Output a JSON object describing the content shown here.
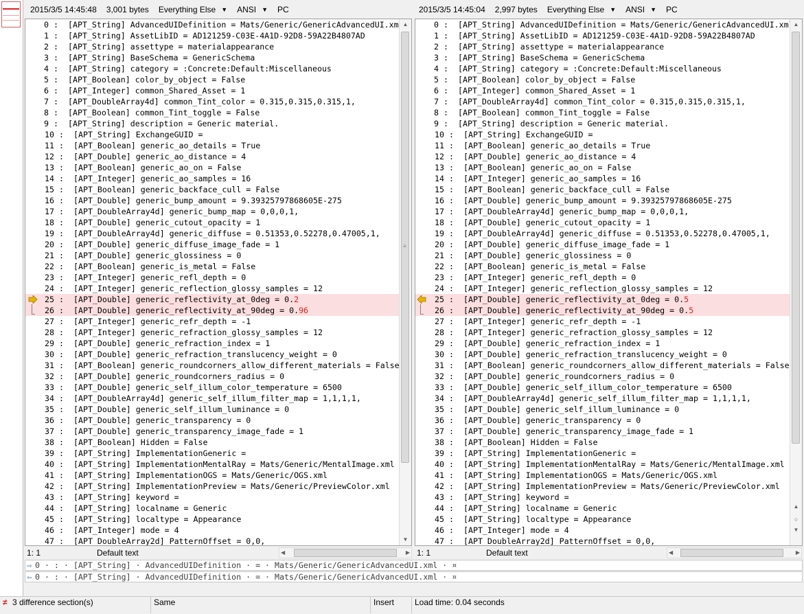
{
  "left": {
    "header": {
      "date": "2015/3/5 14:45:48",
      "size": "3,001 bytes",
      "filter": "Everything Else",
      "encoding": "ANSI",
      "line_ending": "PC"
    },
    "status": {
      "position": "1: 1",
      "style": "Default text"
    },
    "lines": [
      {
        "n": "0",
        "t": "[APT_String] AdvancedUIDefinition = Mats/Generic/GenericAdvancedUI.xml"
      },
      {
        "n": "1",
        "t": "[APT_String] AssetLibID = AD121259-C03E-4A1D-92D8-59A22B4807AD"
      },
      {
        "n": "2",
        "t": "[APT_String] assettype = materialappearance"
      },
      {
        "n": "3",
        "t": "[APT_String] BaseSchema = GenericSchema"
      },
      {
        "n": "4",
        "t": "[APT_String] category = :Concrete:Default:Miscellaneous"
      },
      {
        "n": "5",
        "t": "[APT_Boolean] color_by_object = False"
      },
      {
        "n": "6",
        "t": "[APT_Integer] common_Shared_Asset = 1"
      },
      {
        "n": "7",
        "t": "[APT_DoubleArray4d] common_Tint_color = 0.315,0.315,0.315,1,"
      },
      {
        "n": "8",
        "t": "[APT_Boolean] common_Tint_toggle = False"
      },
      {
        "n": "9",
        "t": "[APT_String] description = Generic material."
      },
      {
        "n": "10",
        "t": "[APT_String] ExchangeGUID ="
      },
      {
        "n": "11",
        "t": "[APT_Boolean] generic_ao_details = True"
      },
      {
        "n": "12",
        "t": "[APT_Double] generic_ao_distance = 4"
      },
      {
        "n": "13",
        "t": "[APT_Boolean] generic_ao_on = False"
      },
      {
        "n": "14",
        "t": "[APT_Integer] generic_ao_samples = 16"
      },
      {
        "n": "15",
        "t": "[APT_Boolean] generic_backface_cull = False"
      },
      {
        "n": "16",
        "t": "[APT_Double] generic_bump_amount = 9.39325797868605E-275"
      },
      {
        "n": "17",
        "t": "[APT_DoubleArray4d] generic_bump_map = 0,0,0,1,"
      },
      {
        "n": "18",
        "t": "[APT_Double] generic_cutout_opacity = 1"
      },
      {
        "n": "19",
        "t": "[APT_DoubleArray4d] generic_diffuse = 0.51353,0.52278,0.47005,1,"
      },
      {
        "n": "20",
        "t": "[APT_Double] generic_diffuse_image_fade = 1"
      },
      {
        "n": "21",
        "t": "[APT_Double] generic_glossiness = 0"
      },
      {
        "n": "22",
        "t": "[APT_Boolean] generic_is_metal = False"
      },
      {
        "n": "23",
        "t": "[APT_Integer] generic_refl_depth = 0"
      },
      {
        "n": "24",
        "t": "[APT_Integer] generic_reflection_glossy_samples = 12"
      },
      {
        "n": "25",
        "t": "[APT_Double] generic_reflectivity_at_0deg = 0.",
        "c": "2",
        "diff": true
      },
      {
        "n": "26",
        "t": "[APT_Double] generic_reflectivity_at_90deg = 0.",
        "c": "96",
        "diff": true
      },
      {
        "n": "27",
        "t": "[APT_Integer] generic_refr_depth = -1"
      },
      {
        "n": "28",
        "t": "[APT_Integer] generic_refraction_glossy_samples = 12"
      },
      {
        "n": "29",
        "t": "[APT_Double] generic_refraction_index = 1"
      },
      {
        "n": "30",
        "t": "[APT_Double] generic_refraction_translucency_weight = 0"
      },
      {
        "n": "31",
        "t": "[APT_Boolean] generic_roundcorners_allow_different_materials = False"
      },
      {
        "n": "32",
        "t": "[APT_Double] generic_roundcorners_radius = 0"
      },
      {
        "n": "33",
        "t": "[APT_Double] generic_self_illum_color_temperature = 6500"
      },
      {
        "n": "34",
        "t": "[APT_DoubleArray4d] generic_self_illum_filter_map = 1,1,1,1,"
      },
      {
        "n": "35",
        "t": "[APT_Double] generic_self_illum_luminance = 0"
      },
      {
        "n": "36",
        "t": "[APT_Double] generic_transparency = 0"
      },
      {
        "n": "37",
        "t": "[APT_Double] generic_transparency_image_fade = 1"
      },
      {
        "n": "38",
        "t": "[APT_Boolean] Hidden = False"
      },
      {
        "n": "39",
        "t": "[APT_String] ImplementationGeneric ="
      },
      {
        "n": "40",
        "t": "[APT_String] ImplementationMentalRay = Mats/Generic/MentalImage.xml"
      },
      {
        "n": "41",
        "t": "[APT_String] ImplementationOGS = Mats/Generic/OGS.xml"
      },
      {
        "n": "42",
        "t": "[APT_String] ImplementationPreview = Mats/Generic/PreviewColor.xml"
      },
      {
        "n": "43",
        "t": "[APT_String] keyword ="
      },
      {
        "n": "44",
        "t": "[APT_String] localname = Generic"
      },
      {
        "n": "45",
        "t": "[APT_String] localtype = Appearance"
      },
      {
        "n": "46",
        "t": "[APT_Integer] mode = 4"
      },
      {
        "n": "47",
        "t": "[APT_DoubleArray2d] PatternOffset = 0,0,"
      }
    ]
  },
  "right": {
    "header": {
      "date": "2015/3/5 14:45:04",
      "size": "2,997 bytes",
      "filter": "Everything Else",
      "encoding": "ANSI",
      "line_ending": "PC"
    },
    "status": {
      "position": "1: 1",
      "style": "Default text"
    },
    "lines": [
      {
        "n": "0",
        "t": "[APT_String] AdvancedUIDefinition = Mats/Generic/GenericAdvancedUI.xml"
      },
      {
        "n": "1",
        "t": "[APT_String] AssetLibID = AD121259-C03E-4A1D-92D8-59A22B4807AD"
      },
      {
        "n": "2",
        "t": "[APT_String] assettype = materialappearance"
      },
      {
        "n": "3",
        "t": "[APT_String] BaseSchema = GenericSchema"
      },
      {
        "n": "4",
        "t": "[APT_String] category = :Concrete:Default:Miscellaneous"
      },
      {
        "n": "5",
        "t": "[APT_Boolean] color_by_object = False"
      },
      {
        "n": "6",
        "t": "[APT_Integer] common_Shared_Asset = 1"
      },
      {
        "n": "7",
        "t": "[APT_DoubleArray4d] common_Tint_color = 0.315,0.315,0.315,1,"
      },
      {
        "n": "8",
        "t": "[APT_Boolean] common_Tint_toggle = False"
      },
      {
        "n": "9",
        "t": "[APT_String] description = Generic material."
      },
      {
        "n": "10",
        "t": "[APT_String] ExchangeGUID ="
      },
      {
        "n": "11",
        "t": "[APT_Boolean] generic_ao_details = True"
      },
      {
        "n": "12",
        "t": "[APT_Double] generic_ao_distance = 4"
      },
      {
        "n": "13",
        "t": "[APT_Boolean] generic_ao_on = False"
      },
      {
        "n": "14",
        "t": "[APT_Integer] generic_ao_samples = 16"
      },
      {
        "n": "15",
        "t": "[APT_Boolean] generic_backface_cull = False"
      },
      {
        "n": "16",
        "t": "[APT_Double] generic_bump_amount = 9.39325797868605E-275"
      },
      {
        "n": "17",
        "t": "[APT_DoubleArray4d] generic_bump_map = 0,0,0,1,"
      },
      {
        "n": "18",
        "t": "[APT_Double] generic_cutout_opacity = 1"
      },
      {
        "n": "19",
        "t": "[APT_DoubleArray4d] generic_diffuse = 0.51353,0.52278,0.47005,1,"
      },
      {
        "n": "20",
        "t": "[APT_Double] generic_diffuse_image_fade = 1"
      },
      {
        "n": "21",
        "t": "[APT_Double] generic_glossiness = 0"
      },
      {
        "n": "22",
        "t": "[APT_Boolean] generic_is_metal = False"
      },
      {
        "n": "23",
        "t": "[APT_Integer] generic_refl_depth = 0"
      },
      {
        "n": "24",
        "t": "[APT_Integer] generic_reflection_glossy_samples = 12"
      },
      {
        "n": "25",
        "t": "[APT_Double] generic_reflectivity_at_0deg = 0.",
        "c": "5",
        "diff": true
      },
      {
        "n": "26",
        "t": "[APT_Double] generic_reflectivity_at_90deg = 0.",
        "c": "5",
        "diff": true
      },
      {
        "n": "27",
        "t": "[APT_Integer] generic_refr_depth = -1"
      },
      {
        "n": "28",
        "t": "[APT_Integer] generic_refraction_glossy_samples = 12"
      },
      {
        "n": "29",
        "t": "[APT_Double] generic_refraction_index = 1"
      },
      {
        "n": "30",
        "t": "[APT_Double] generic_refraction_translucency_weight = 0"
      },
      {
        "n": "31",
        "t": "[APT_Boolean] generic_roundcorners_allow_different_materials = False"
      },
      {
        "n": "32",
        "t": "[APT_Double] generic_roundcorners_radius = 0"
      },
      {
        "n": "33",
        "t": "[APT_Double] generic_self_illum_color_temperature = 6500"
      },
      {
        "n": "34",
        "t": "[APT_DoubleArray4d] generic_self_illum_filter_map = 1,1,1,1,"
      },
      {
        "n": "35",
        "t": "[APT_Double] generic_self_illum_luminance = 0"
      },
      {
        "n": "36",
        "t": "[APT_Double] generic_transparency = 0"
      },
      {
        "n": "37",
        "t": "[APT_Double] generic_transparency_image_fade = 1"
      },
      {
        "n": "38",
        "t": "[APT_Boolean] Hidden = False"
      },
      {
        "n": "39",
        "t": "[APT_String] ImplementationGeneric ="
      },
      {
        "n": "40",
        "t": "[APT_String] ImplementationMentalRay = Mats/Generic/MentalImage.xml"
      },
      {
        "n": "41",
        "t": "[APT_String] ImplementationOGS = Mats/Generic/OGS.xml"
      },
      {
        "n": "42",
        "t": "[APT_String] ImplementationPreview = Mats/Generic/PreviewColor.xml"
      },
      {
        "n": "43",
        "t": "[APT_String] keyword ="
      },
      {
        "n": "44",
        "t": "[APT_String] localname = Generic"
      },
      {
        "n": "45",
        "t": "[APT_String] localtype = Appearance"
      },
      {
        "n": "46",
        "t": "[APT_Integer] mode = 4"
      },
      {
        "n": "47",
        "t": "[APT_DoubleArray2d] PatternOffset = 0,0,"
      }
    ]
  },
  "compare": {
    "line1": "0 · : · [APT_String] · AdvancedUIDefinition · = · Mats/Generic/GenericAdvancedUI.xml · ¤",
    "line2": "0 · : · [APT_String] · AdvancedUIDefinition · = · Mats/Generic/GenericAdvancedUI.xml · ¤"
  },
  "statusbar": {
    "differences": "3 difference section(s)",
    "same": "Same",
    "mode": "Insert",
    "load_time": "Load time: 0.04 seconds"
  },
  "colors": {
    "diff_bg": "#fbdedf",
    "diff_text": "#e02020",
    "gutter_arrow": "#e8b400"
  },
  "icons": {
    "prev_diff": "arrow-right-icon",
    "next_diff": "arrow-left-icon",
    "diff_status": "diff-mark-icon"
  }
}
